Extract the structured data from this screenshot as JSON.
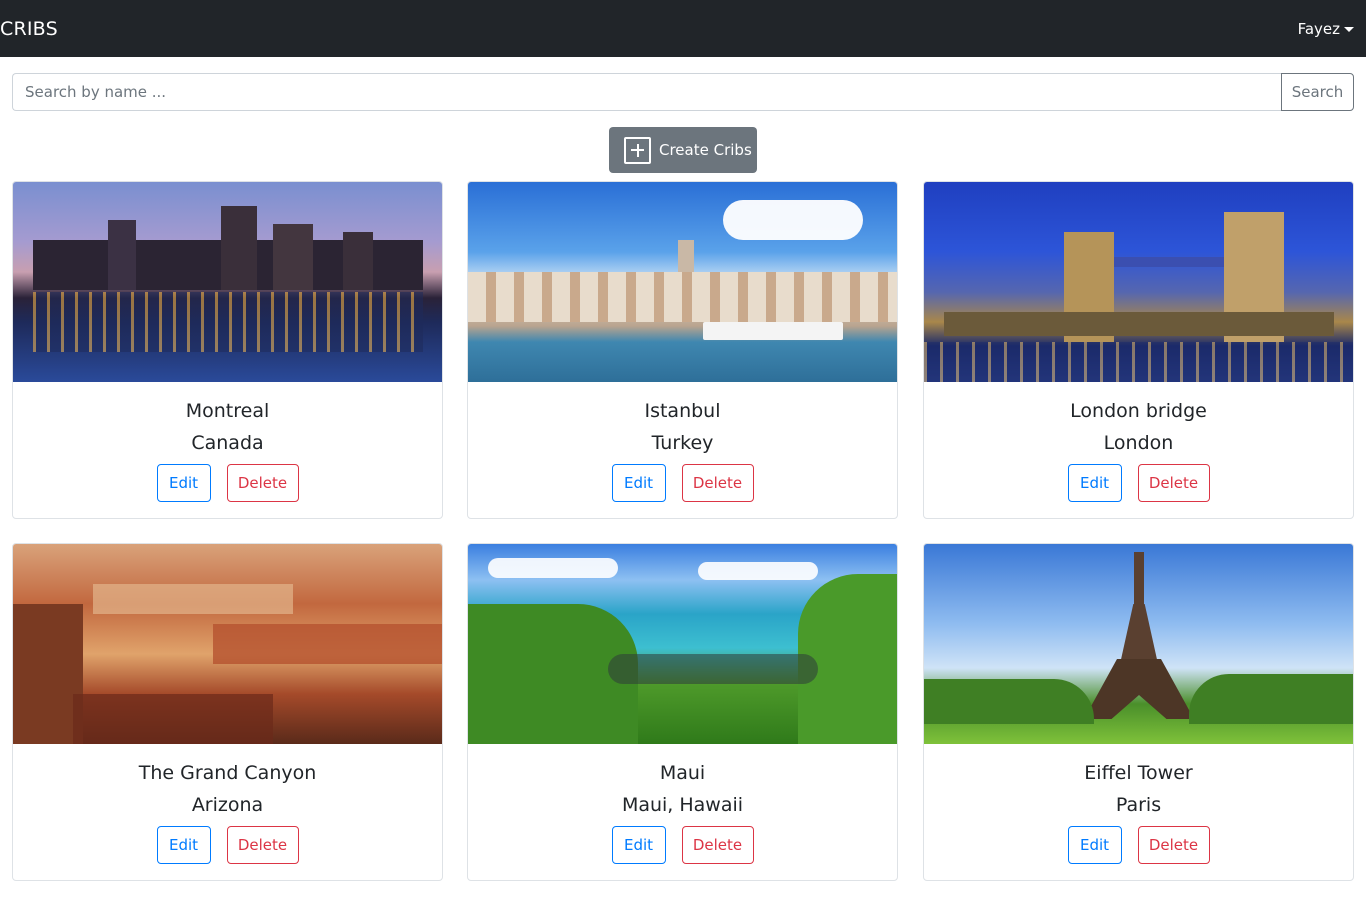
{
  "navbar": {
    "brand": "CRIBS",
    "user": "Fayez"
  },
  "search": {
    "placeholder": "Search by name ...",
    "button_label": "Search"
  },
  "create_button": {
    "label": "Create Cribs"
  },
  "cards": [
    {
      "title": "Montreal",
      "location": "Canada",
      "edit_label": "Edit",
      "delete_label": "Delete"
    },
    {
      "title": "Istanbul",
      "location": "Turkey",
      "edit_label": "Edit",
      "delete_label": "Delete"
    },
    {
      "title": "London bridge",
      "location": "London",
      "edit_label": "Edit",
      "delete_label": "Delete"
    },
    {
      "title": "The Grand Canyon",
      "location": "Arizona",
      "edit_label": "Edit",
      "delete_label": "Delete"
    },
    {
      "title": "Maui",
      "location": "Maui, Hawaii",
      "edit_label": "Edit",
      "delete_label": "Delete"
    },
    {
      "title": "Eiffel Tower",
      "location": "Paris",
      "edit_label": "Edit",
      "delete_label": "Delete"
    }
  ],
  "colors": {
    "navbar_bg": "#212529",
    "primary": "#007bff",
    "danger": "#dc3545",
    "secondary": "#6c757d"
  }
}
